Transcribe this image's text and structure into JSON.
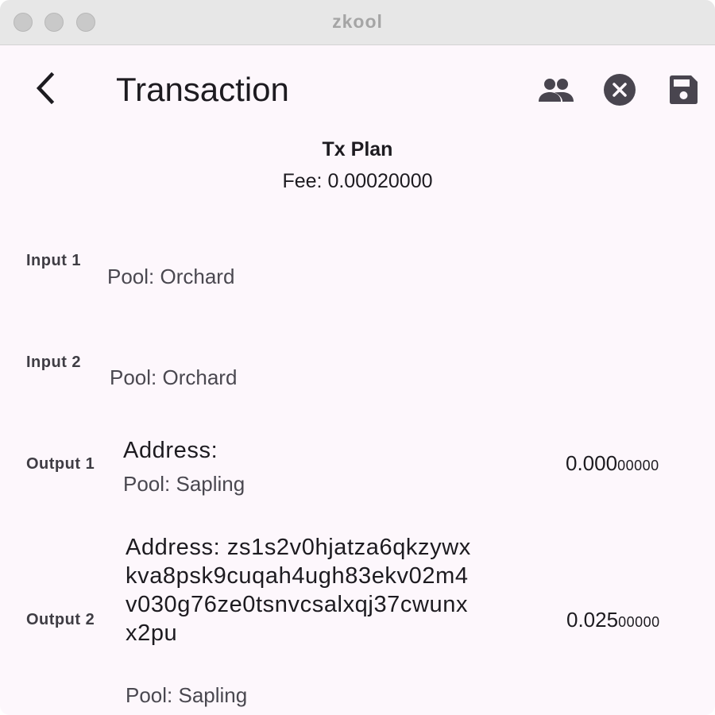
{
  "window": {
    "title": "zkool"
  },
  "appbar": {
    "title": "Transaction",
    "back_icon": "arrow-back-icon",
    "actions": [
      "people-icon",
      "cancel-icon",
      "save-icon"
    ]
  },
  "plan": {
    "title": "Tx Plan",
    "fee": "Fee: 0.00020000"
  },
  "inputs": [
    {
      "label": "Input 1",
      "pool": "Pool: Orchard"
    },
    {
      "label": "Input 2",
      "pool": "Pool: Orchard"
    }
  ],
  "outputs": [
    {
      "label": "Output 1",
      "address_lines": [
        "Address:"
      ],
      "pool": "Pool: Sapling",
      "amount_main": "0.000",
      "amount_small": "00000"
    },
    {
      "label": "Output 2",
      "address_lines": [
        "Address: zs1s2v0hjatza6qkzywx",
        "kva8psk9cuqah4ugh83ekv02m4",
        "v030g76ze0tsnvcsalxqj37cwunx",
        "x2pu"
      ],
      "pool": "Pool: Sapling",
      "amount_main": "0.025",
      "amount_small": "00000"
    }
  ],
  "colors": {
    "background": "#fdf7fc",
    "titlebar": "#e7e7e7",
    "icon": "#49454f",
    "text": "#1d1b20"
  }
}
